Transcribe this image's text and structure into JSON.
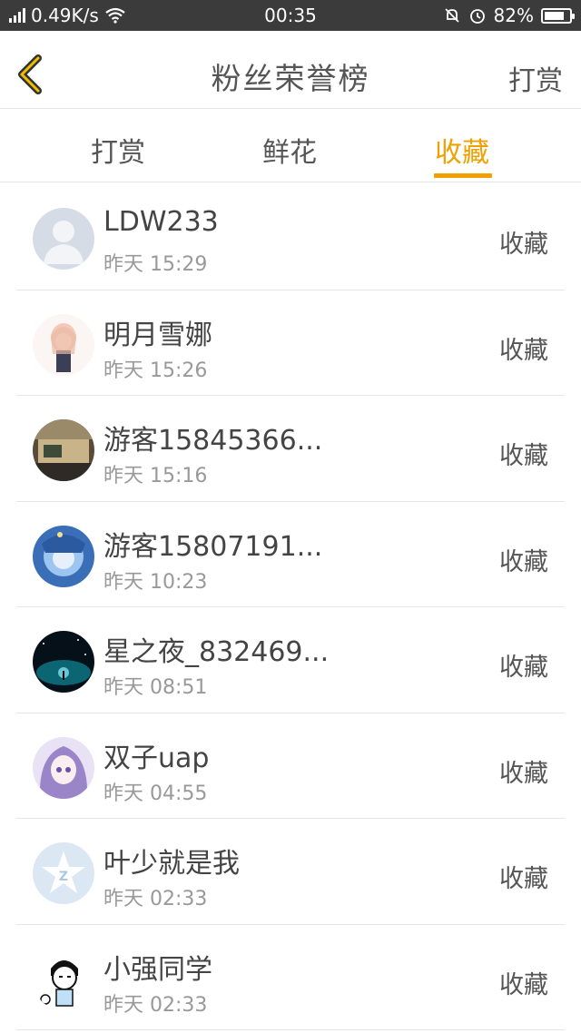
{
  "status_bar": {
    "network": "4G",
    "speed": "0.49K/s",
    "time": "00:35",
    "battery": "82%",
    "battery_level": 0.82
  },
  "header": {
    "title": "粉丝荣誉榜",
    "right_action": "打赏"
  },
  "tabs": [
    {
      "label": "打赏",
      "active": false
    },
    {
      "label": "鲜花",
      "active": false
    },
    {
      "label": "收藏",
      "active": true
    }
  ],
  "accent_color": "#f0a000",
  "fans": [
    {
      "name": "LDW233",
      "time": "昨天 15:29",
      "action": "收藏",
      "avatar": "default-avatar-icon"
    },
    {
      "name": "明月雪娜",
      "time": "昨天 15:26",
      "action": "收藏",
      "avatar": "anime-girl-avatar"
    },
    {
      "name": "游客15845366...",
      "time": "昨天 15:16",
      "action": "收藏",
      "avatar": "photo-avatar"
    },
    {
      "name": "游客15807191...",
      "time": "昨天 10:23",
      "action": "收藏",
      "avatar": "blue-anime-avatar"
    },
    {
      "name": "星之夜_832469...",
      "time": "昨天 08:51",
      "action": "收藏",
      "avatar": "night-sky-avatar"
    },
    {
      "name": "双子uap",
      "time": "昨天 04:55",
      "action": "收藏",
      "avatar": "purple-anime-avatar"
    },
    {
      "name": "叶少就是我",
      "time": "昨天 02:33",
      "action": "收藏",
      "avatar": "qzone-star-avatar"
    },
    {
      "name": "小强同学",
      "time": "昨天 02:33",
      "action": "收藏",
      "avatar": "cartoon-boy-avatar"
    }
  ]
}
